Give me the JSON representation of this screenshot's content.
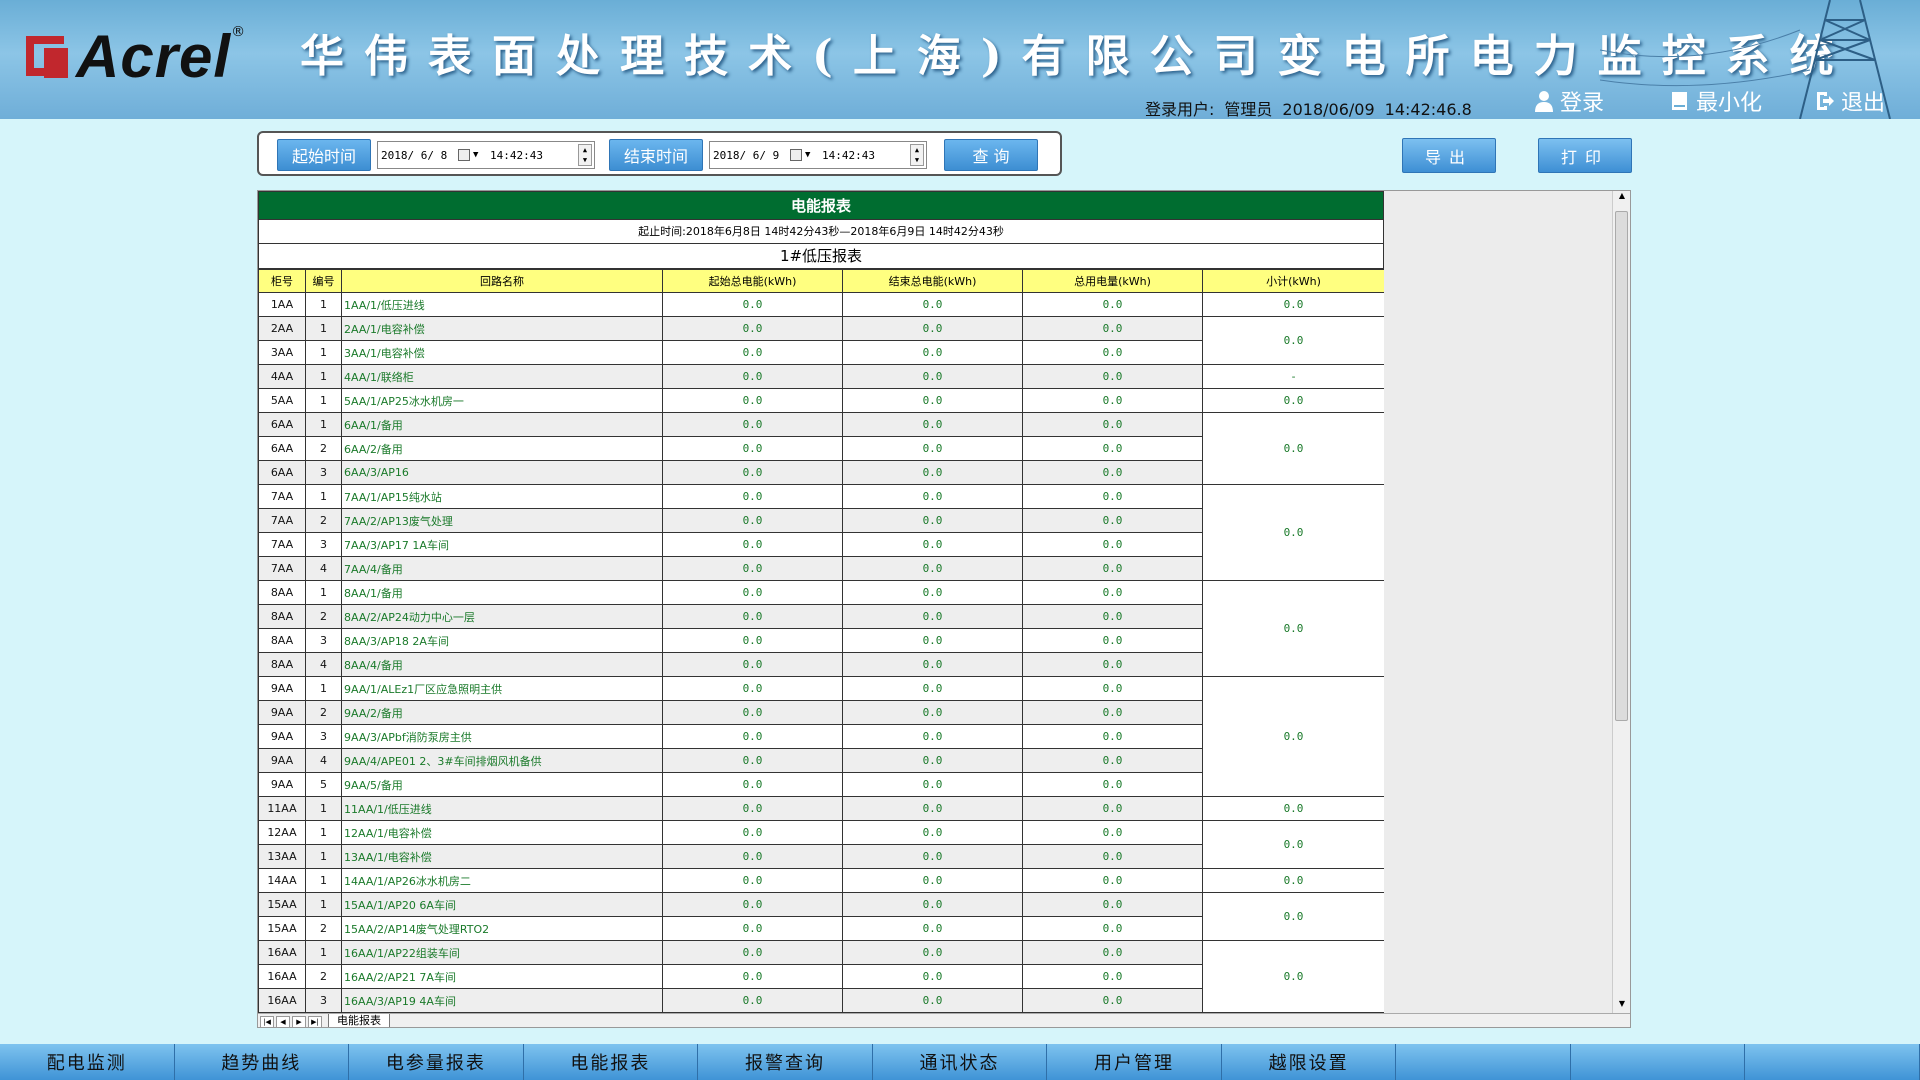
{
  "header": {
    "logo_text": "Acrel",
    "title": "华伟表面处理技术(上海)有限公司变电所电力监控系统",
    "user_label": "登录用户:",
    "user_name": "管理员",
    "date": "2018/06/09",
    "time": "14:42:46.8",
    "login_label": "登录",
    "minimize_label": "最小化",
    "exit_label": "退出"
  },
  "query": {
    "start_label": "起始时间",
    "start_date": "2018/ 6/ 8",
    "start_time": "14:42:43",
    "end_label": "结束时间",
    "end_date": "2018/ 6/ 9",
    "end_time": "14:42:43",
    "search_label": "查 询"
  },
  "actions": {
    "export_label": "导出",
    "print_label": "打印"
  },
  "report": {
    "title": "电能报表",
    "range": "起止时间:2018年6月8日 14时42分43秒—2018年6月9日 14时42分43秒",
    "subtitle": "1#低压报表",
    "columns": [
      "柜号",
      "编号",
      "回路名称",
      "起始总电能(kWh)",
      "结束总电能(kWh)",
      "总用电量(kWh)",
      "小计(kWh)"
    ],
    "rows": [
      {
        "cab": "1AA",
        "no": "1",
        "name": "1AA/1/低压进线",
        "start": "0.0",
        "end": "0.0",
        "total": "0.0"
      },
      {
        "cab": "2AA",
        "no": "1",
        "name": "2AA/1/电容补偿",
        "start": "0.0",
        "end": "0.0",
        "total": "0.0"
      },
      {
        "cab": "3AA",
        "no": "1",
        "name": "3AA/1/电容补偿",
        "start": "0.0",
        "end": "0.0",
        "total": "0.0"
      },
      {
        "cab": "4AA",
        "no": "1",
        "name": "4AA/1/联络柜",
        "start": "0.0",
        "end": "0.0",
        "total": "0.0"
      },
      {
        "cab": "5AA",
        "no": "1",
        "name": "5AA/1/AP25冰水机房一",
        "start": "0.0",
        "end": "0.0",
        "total": "0.0"
      },
      {
        "cab": "6AA",
        "no": "1",
        "name": "6AA/1/备用",
        "start": "0.0",
        "end": "0.0",
        "total": "0.0"
      },
      {
        "cab": "6AA",
        "no": "2",
        "name": "6AA/2/备用",
        "start": "0.0",
        "end": "0.0",
        "total": "0.0"
      },
      {
        "cab": "6AA",
        "no": "3",
        "name": "6AA/3/AP16",
        "start": "0.0",
        "end": "0.0",
        "total": "0.0"
      },
      {
        "cab": "7AA",
        "no": "1",
        "name": "7AA/1/AP15纯水站",
        "start": "0.0",
        "end": "0.0",
        "total": "0.0"
      },
      {
        "cab": "7AA",
        "no": "2",
        "name": "7AA/2/AP13废气处理",
        "start": "0.0",
        "end": "0.0",
        "total": "0.0"
      },
      {
        "cab": "7AA",
        "no": "3",
        "name": "7AA/3/AP17 1A车间",
        "start": "0.0",
        "end": "0.0",
        "total": "0.0"
      },
      {
        "cab": "7AA",
        "no": "4",
        "name": "7AA/4/备用",
        "start": "0.0",
        "end": "0.0",
        "total": "0.0"
      },
      {
        "cab": "8AA",
        "no": "1",
        "name": "8AA/1/备用",
        "start": "0.0",
        "end": "0.0",
        "total": "0.0"
      },
      {
        "cab": "8AA",
        "no": "2",
        "name": "8AA/2/AP24动力中心一层",
        "start": "0.0",
        "end": "0.0",
        "total": "0.0"
      },
      {
        "cab": "8AA",
        "no": "3",
        "name": "8AA/3/AP18 2A车间",
        "start": "0.0",
        "end": "0.0",
        "total": "0.0"
      },
      {
        "cab": "8AA",
        "no": "4",
        "name": "8AA/4/备用",
        "start": "0.0",
        "end": "0.0",
        "total": "0.0"
      },
      {
        "cab": "9AA",
        "no": "1",
        "name": "9AA/1/ALEz1厂区应急照明主供",
        "start": "0.0",
        "end": "0.0",
        "total": "0.0"
      },
      {
        "cab": "9AA",
        "no": "2",
        "name": "9AA/2/备用",
        "start": "0.0",
        "end": "0.0",
        "total": "0.0"
      },
      {
        "cab": "9AA",
        "no": "3",
        "name": "9AA/3/APbf消防泵房主供",
        "start": "0.0",
        "end": "0.0",
        "total": "0.0"
      },
      {
        "cab": "9AA",
        "no": "4",
        "name": "9AA/4/APE01 2、3#车间排烟风机备供",
        "start": "0.0",
        "end": "0.0",
        "total": "0.0"
      },
      {
        "cab": "9AA",
        "no": "5",
        "name": "9AA/5/备用",
        "start": "0.0",
        "end": "0.0",
        "total": "0.0"
      },
      {
        "cab": "11AA",
        "no": "1",
        "name": "11AA/1/低压进线",
        "start": "0.0",
        "end": "0.0",
        "total": "0.0"
      },
      {
        "cab": "12AA",
        "no": "1",
        "name": "12AA/1/电容补偿",
        "start": "0.0",
        "end": "0.0",
        "total": "0.0"
      },
      {
        "cab": "13AA",
        "no": "1",
        "name": "13AA/1/电容补偿",
        "start": "0.0",
        "end": "0.0",
        "total": "0.0"
      },
      {
        "cab": "14AA",
        "no": "1",
        "name": "14AA/1/AP26冰水机房二",
        "start": "0.0",
        "end": "0.0",
        "total": "0.0"
      },
      {
        "cab": "15AA",
        "no": "1",
        "name": "15AA/1/AP20 6A车间",
        "start": "0.0",
        "end": "0.0",
        "total": "0.0"
      },
      {
        "cab": "15AA",
        "no": "2",
        "name": "15AA/2/AP14废气处理RTO2",
        "start": "0.0",
        "end": "0.0",
        "total": "0.0"
      },
      {
        "cab": "16AA",
        "no": "1",
        "name": "16AA/1/AP22组装车间",
        "start": "0.0",
        "end": "0.0",
        "total": "0.0"
      },
      {
        "cab": "16AA",
        "no": "2",
        "name": "16AA/2/AP21 7A车间",
        "start": "0.0",
        "end": "0.0",
        "total": "0.0"
      },
      {
        "cab": "16AA",
        "no": "3",
        "name": "16AA/3/AP19 4A车间",
        "start": "0.0",
        "end": "0.0",
        "total": "0.0"
      }
    ],
    "subtotals": [
      {
        "start": 0,
        "span": 1,
        "value": "0.0"
      },
      {
        "start": 1,
        "span": 2,
        "value": "0.0"
      },
      {
        "start": 3,
        "span": 1,
        "value": "-"
      },
      {
        "start": 4,
        "span": 1,
        "value": "0.0"
      },
      {
        "start": 5,
        "span": 3,
        "value": "0.0"
      },
      {
        "start": 8,
        "span": 4,
        "value": "0.0"
      },
      {
        "start": 12,
        "span": 4,
        "value": "0.0"
      },
      {
        "start": 16,
        "span": 5,
        "value": "0.0"
      },
      {
        "start": 21,
        "span": 1,
        "value": "0.0"
      },
      {
        "start": 22,
        "span": 2,
        "value": "0.0"
      },
      {
        "start": 24,
        "span": 1,
        "value": "0.0"
      },
      {
        "start": 25,
        "span": 2,
        "value": "0.0"
      },
      {
        "start": 27,
        "span": 3,
        "value": "0.0"
      }
    ],
    "sheet_tab": "电能报表"
  },
  "nav": {
    "items": [
      "配电监测",
      "趋势曲线",
      "电参量报表",
      "电能报表",
      "报警查询",
      "通讯状态",
      "用户管理",
      "越限设置",
      "",
      "",
      ""
    ]
  },
  "colors": {
    "header_bg": "#8cc5e6",
    "title_green": "#006d30",
    "column_header_yellow": "#ffff80",
    "value_green": "#1a7a2a",
    "button_blue": "#3d8ed2",
    "logo_red": "#c1272d"
  },
  "icons": {
    "login": "user-icon",
    "minimize": "minimize-icon",
    "exit": "exit-icon",
    "calendar": "calendar-icon"
  }
}
